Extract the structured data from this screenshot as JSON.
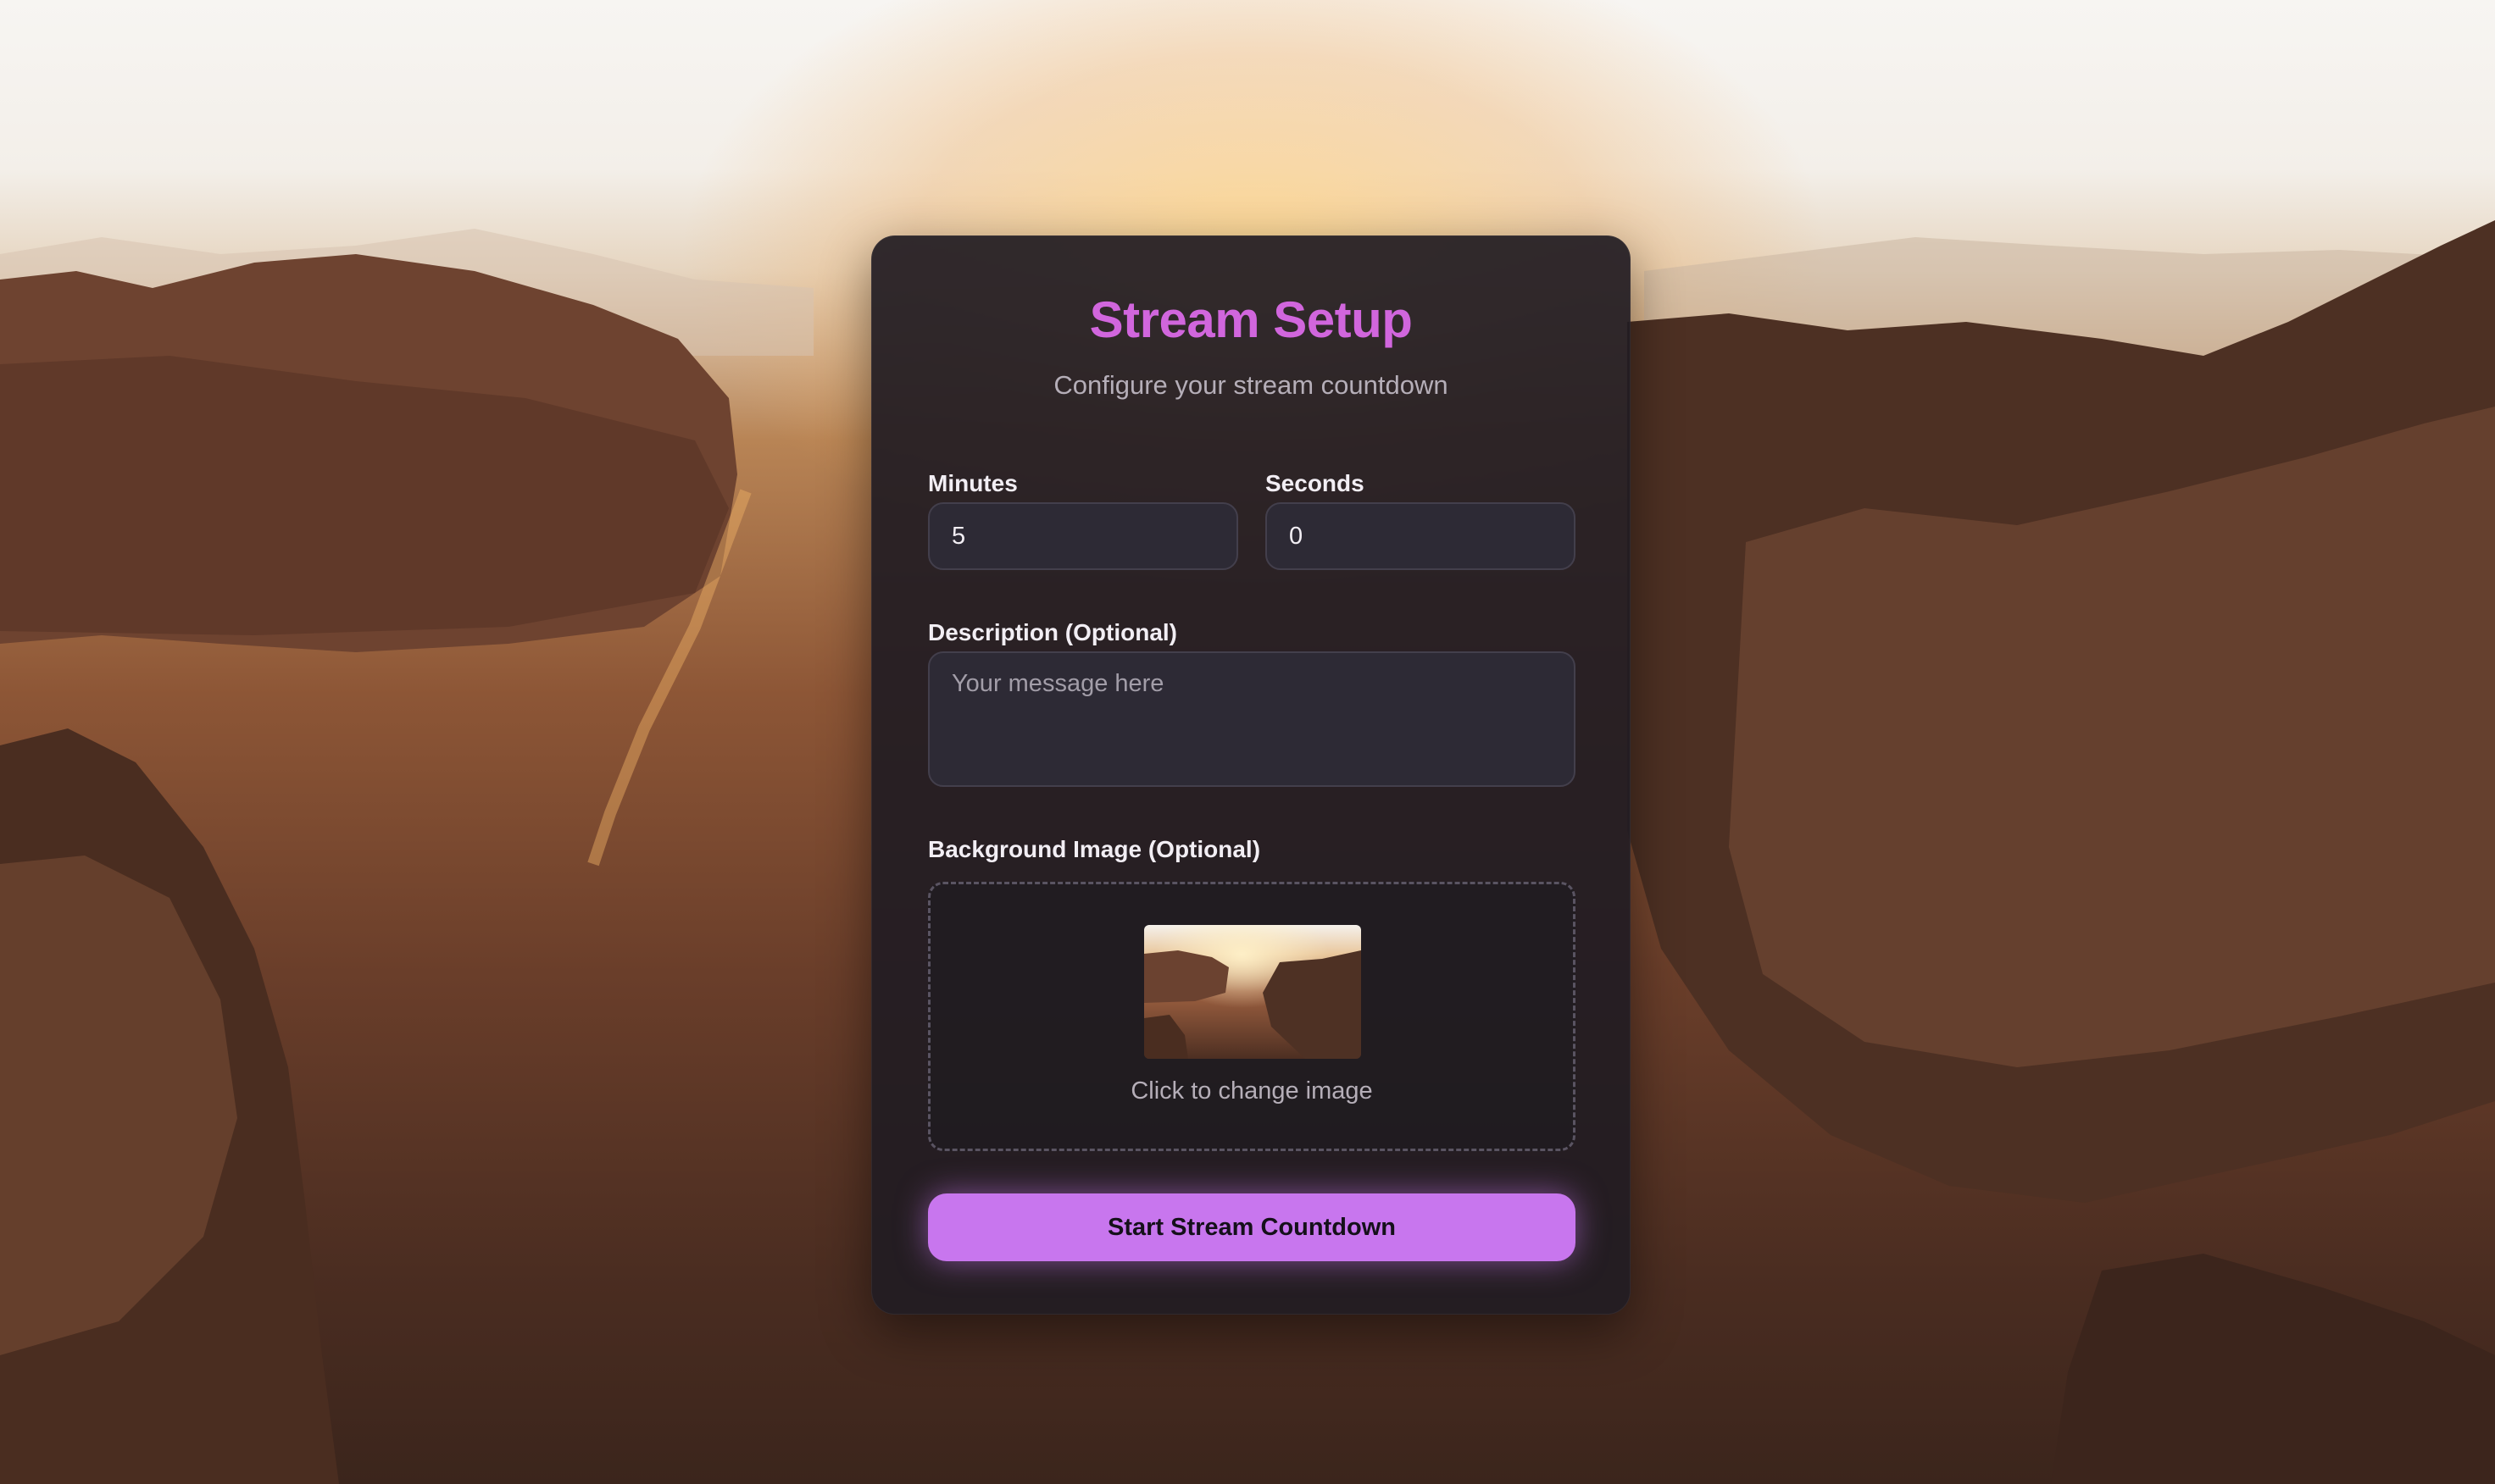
{
  "setup": {
    "title": "Stream Setup",
    "subtitle": "Configure your stream countdown"
  },
  "form": {
    "minutes_label": "Minutes",
    "minutes_value": "5",
    "seconds_label": "Seconds",
    "seconds_value": "0",
    "description_label": "Description (Optional)",
    "description_placeholder": "Your message here",
    "image_label": "Background Image (Optional)",
    "image_hint": "Click to change image"
  },
  "actions": {
    "start_label": "Start Stream Countdown"
  },
  "colors": {
    "accent": "#c876ee",
    "title": "#d166dd",
    "card_bg": "#211c22"
  }
}
